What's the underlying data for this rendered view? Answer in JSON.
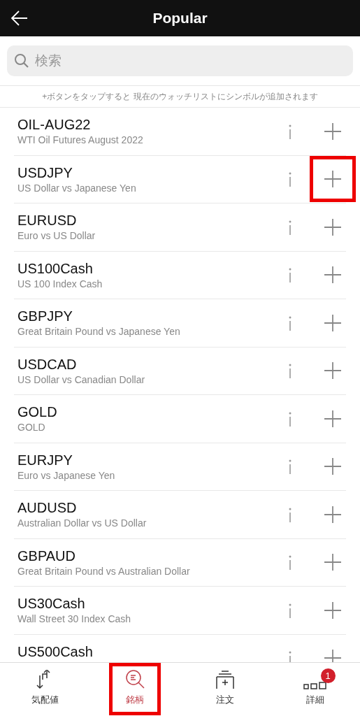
{
  "header": {
    "title": "Popular"
  },
  "search": {
    "placeholder": "検索"
  },
  "hint": "+ボタンをタップすると 現在のウォッチリストにシンボルが追加されます",
  "rows": [
    {
      "symbol": "OIL-AUG22",
      "description": "WTI Oil Futures August 2022",
      "highlighted": false
    },
    {
      "symbol": "USDJPY",
      "description": "US Dollar vs Japanese Yen",
      "highlighted": true
    },
    {
      "symbol": "EURUSD",
      "description": "Euro vs US Dollar",
      "highlighted": false
    },
    {
      "symbol": "US100Cash",
      "description": "US 100 Index Cash",
      "highlighted": false
    },
    {
      "symbol": "GBPJPY",
      "description": "Great Britain Pound vs Japanese Yen",
      "highlighted": false
    },
    {
      "symbol": "USDCAD",
      "description": "US Dollar vs Canadian Dollar",
      "highlighted": false
    },
    {
      "symbol": "GOLD",
      "description": "GOLD",
      "highlighted": false
    },
    {
      "symbol": "EURJPY",
      "description": "Euro vs Japanese Yen",
      "highlighted": false
    },
    {
      "symbol": "AUDUSD",
      "description": "Australian Dollar vs US Dollar",
      "highlighted": false
    },
    {
      "symbol": "GBPAUD",
      "description": "Great Britain Pound vs Australian Dollar",
      "highlighted": false
    },
    {
      "symbol": "US30Cash",
      "description": "Wall Street 30 Index Cash",
      "highlighted": false
    },
    {
      "symbol": "US500Cash",
      "highlighted": false
    }
  ],
  "nav": [
    {
      "kind": "quotes",
      "label": "気配値",
      "selected": false,
      "highlighted": false
    },
    {
      "kind": "symbols",
      "label": "銘柄",
      "selected": true,
      "highlighted": true
    },
    {
      "kind": "order",
      "label": "注文",
      "selected": false,
      "highlighted": false
    },
    {
      "kind": "more",
      "label": "詳細",
      "selected": false,
      "highlighted": false,
      "badge": "1"
    }
  ]
}
